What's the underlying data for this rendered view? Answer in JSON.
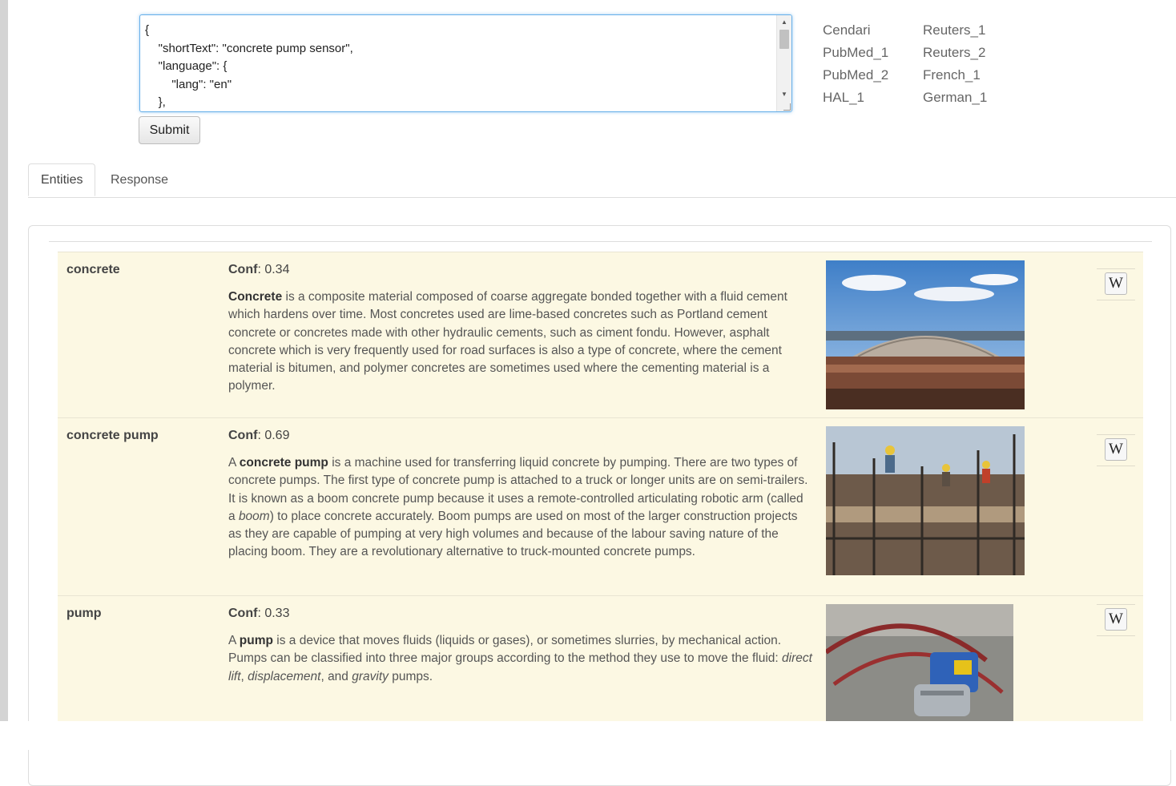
{
  "query": {
    "text": "{\n    \"shortText\": \"concrete pump sensor\",\n    \"language\": {\n        \"lang\": \"en\"\n    },"
  },
  "submit_label": "Submit",
  "corpora": {
    "col1": [
      "Cendari",
      "PubMed_1",
      "PubMed_2",
      "HAL_1"
    ],
    "col2": [
      "Reuters_1",
      "Reuters_2",
      "French_1",
      "German_1"
    ]
  },
  "tabs": [
    {
      "label": "Entities"
    },
    {
      "label": "Response"
    }
  ],
  "conf_label": "Conf",
  "wiki_icon_glyph": "W",
  "entities": [
    {
      "name": "concrete",
      "conf": "0.34",
      "desc_bold": "Concrete",
      "desc_rest": " is a composite material composed of coarse aggregate bonded together with a fluid cement which hardens over time. Most concretes used are lime-based concretes such as Portland cement concrete or concretes made with other hydraulic cements, such as ciment fondu. However, asphalt concrete which is very frequently used for road surfaces is also a type of concrete, where the cement material is bitumen, and polymer concretes are sometimes used where the cementing material is a polymer."
    },
    {
      "name": "concrete pump",
      "conf": "0.69",
      "desc_a": "A ",
      "desc_bold": "concrete pump",
      "desc_b": " is a machine used for transferring liquid concrete by pumping. There are two types of concrete pumps. The first type of concrete pump is attached to a truck or longer units are on semi-trailers. It is known as a boom concrete pump because it uses a remote-controlled articulating robotic arm (called a ",
      "desc_italic": "boom",
      "desc_c": ") to place concrete accurately. Boom pumps are used on most of the larger construction projects as they are capable of pumping at very high volumes and because of the labour saving nature of the placing boom. They are a revolutionary alternative to truck-mounted concrete pumps."
    },
    {
      "name": "pump",
      "conf": "0.33",
      "desc_a": "A ",
      "desc_bold": "pump",
      "desc_b": " is a device that moves fluids (liquids or gases), or sometimes slurries, by mechanical action. Pumps can be classified into three major groups according to the method they use to move the fluid: ",
      "desc_i1": "direct lift",
      "desc_c": ", ",
      "desc_i2": "displacement",
      "desc_d": ", and ",
      "desc_i3": "gravity",
      "desc_e": " pumps."
    }
  ]
}
